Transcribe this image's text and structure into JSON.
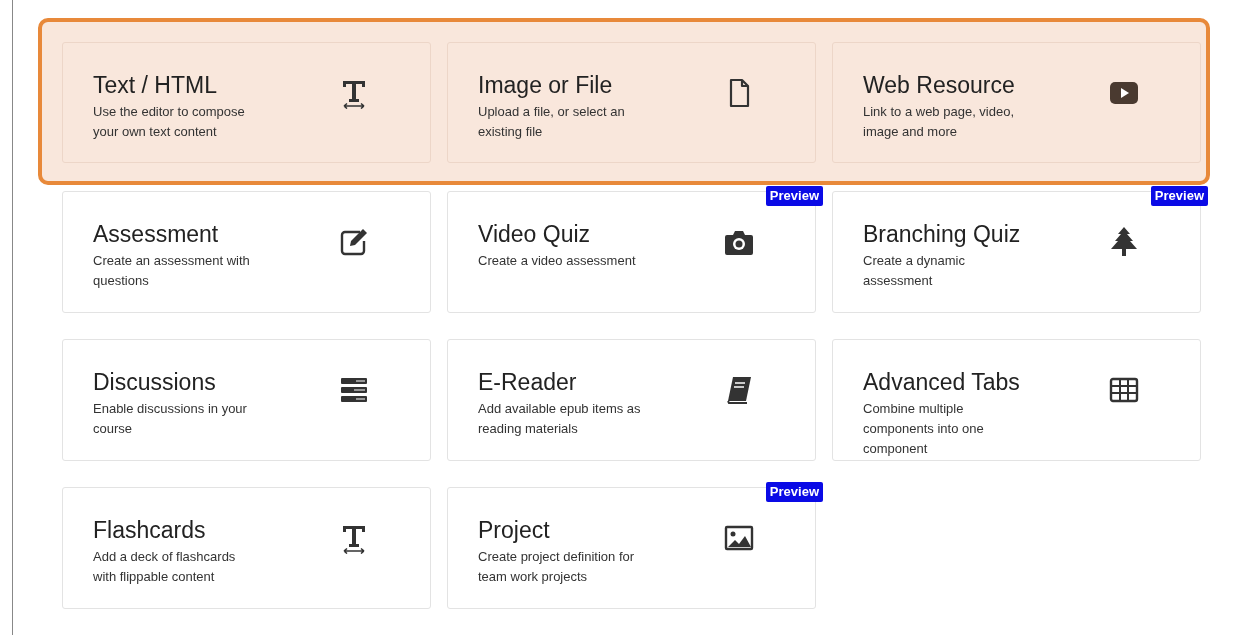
{
  "highlighted_cards": [
    {
      "title": "Text / HTML",
      "description": "Use the editor to compose your own text content",
      "kind": "text"
    },
    {
      "title": "Image or File",
      "description": "Upload a file, or select an existing file",
      "kind": "file"
    },
    {
      "title": "Web Resource",
      "description": "Link to a web page, video, image and more",
      "kind": "play"
    }
  ],
  "cards": [
    {
      "title": "Assessment",
      "description": "Create an assessment with questions",
      "kind": "edit"
    },
    {
      "title": "Video Quiz",
      "description": "Create a video assessment",
      "kind": "camera",
      "badge": "Preview"
    },
    {
      "title": "Branching Quiz",
      "description": "Create a dynamic assessment",
      "kind": "tree",
      "badge": "Preview"
    },
    {
      "title": "Discussions",
      "description": "Enable discussions in your course",
      "kind": "stack"
    },
    {
      "title": "E-Reader",
      "description": "Add available epub items as reading materials",
      "kind": "book"
    },
    {
      "title": "Advanced Tabs",
      "description": "Combine multiple components into one component",
      "kind": "grid"
    },
    {
      "title": "Flashcards",
      "description": "Add a deck of flashcards with flippable content",
      "kind": "text"
    },
    {
      "title": "Project",
      "description": "Create project definition for team work projects",
      "kind": "image",
      "badge": "Preview"
    }
  ]
}
